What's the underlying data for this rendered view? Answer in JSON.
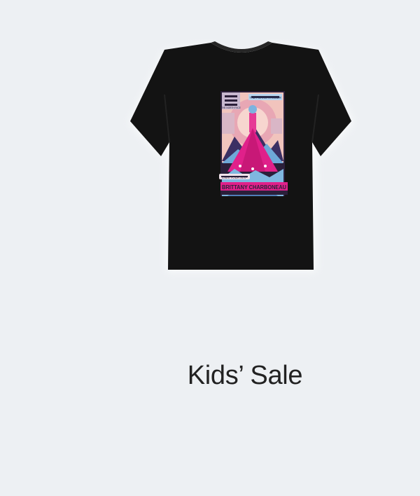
{
  "card": {
    "title": "Kids’ Sale",
    "image": {
      "shirt_color": "#131313",
      "graphic_badge": "THE NORTH FACE",
      "graphic_banner_top": "THE PEAKS RANGER",
      "graphic_caption": "OWN YOUR MAP",
      "graphic_name": "BRITTANY CHARBONEAU",
      "colors": {
        "background": "#edf0f3",
        "shirt": "#131313",
        "accent_pink": "#e0208a",
        "accent_blue": "#7fb7e0",
        "accent_peach": "#f4c3b8"
      }
    }
  }
}
